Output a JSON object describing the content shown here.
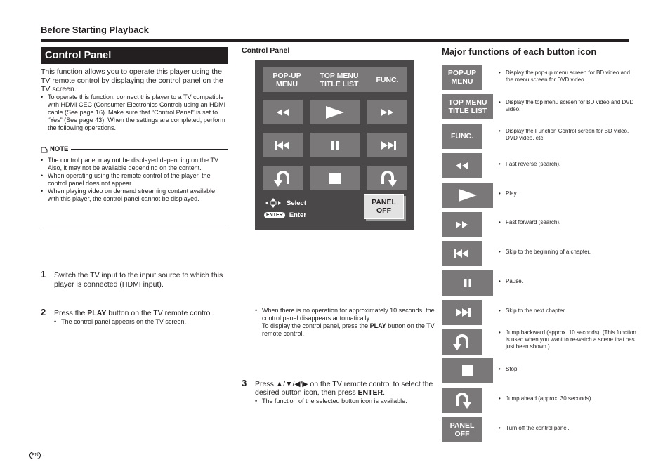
{
  "header": {
    "section": "Before Starting Playback"
  },
  "left": {
    "title": "Control Panel",
    "intro": "This function allows you to operate this player using the TV remote control by displaying the control panel on the TV screen.",
    "intro_bullet": "To operate this function, connect this player to a TV compatible with HDMI CEC (Consumer Electronics Control) using an HDMI cable (See page 16). Make sure that “Control Panel” is set to “Yes” (See page 43). When the settings are completed, perform the following operations.",
    "note_label": "NOTE",
    "notes": [
      "The control panel may not be displayed depending on the TV. Also, it may not be available depending on the content.",
      "When operating using the remote control of the player, the control panel does not appear.",
      "When playing video on demand streaming content available with this player, the control panel cannot be displayed."
    ],
    "steps": [
      {
        "num": "1",
        "text": "Switch the TV input to the input source to which this player is connected (HDMI input)."
      },
      {
        "num": "2",
        "pre": "Press the ",
        "bold": "PLAY",
        "post": " button on the TV remote control.",
        "sub": "The control panel appears on the TV screen."
      }
    ]
  },
  "middle": {
    "label": "Control Panel",
    "buttons": {
      "popup_menu": "POP-UP MENU",
      "top_menu": "TOP MENU TITLE LIST",
      "func": "FUNC.",
      "panel_off": "PANEL OFF"
    },
    "legend": {
      "select": "Select",
      "enter_key": "ENTER",
      "enter": "Enter"
    },
    "bullet_pre": "When there is no operation for approximately 10 seconds, the control panel disappears automatically.",
    "bullet_line2_pre": "To display the control panel, press the ",
    "bullet_line2_bold": "PLAY",
    "bullet_line2_post": " button on the TV remote control.",
    "step3": {
      "num": "3",
      "pre": "Press ▲/▼/◀/▶ on the TV remote control to select the desired button icon, then press ",
      "bold": "ENTER",
      "post": ".",
      "sub": "The function of the selected button icon is available."
    }
  },
  "right": {
    "title": "Major functions of each button icon",
    "items": [
      {
        "icon": "popup-menu",
        "label": "POP-UP MENU",
        "desc": "Display the pop-up menu screen for BD video and the menu screen for DVD video."
      },
      {
        "icon": "top-menu",
        "label": "TOP MENU TITLE LIST",
        "desc": "Display the top menu screen for BD video and DVD video."
      },
      {
        "icon": "func",
        "label": "FUNC.",
        "desc": "Display the Function Control screen for BD video, DVD video, etc."
      },
      {
        "icon": "fast-reverse",
        "desc": "Fast reverse (search)."
      },
      {
        "icon": "play",
        "desc": "Play."
      },
      {
        "icon": "fast-forward",
        "desc": "Fast forward (search)."
      },
      {
        "icon": "skip-back",
        "desc": "Skip to the beginning of a chapter."
      },
      {
        "icon": "pause",
        "desc": "Pause."
      },
      {
        "icon": "skip-next",
        "desc": "Skip to the next chapter."
      },
      {
        "icon": "jump-back",
        "desc": "Jump backward (approx. 10 seconds). (This function is used when you want to re-watch a scene that has just been shown.)"
      },
      {
        "icon": "stop",
        "desc": "Stop."
      },
      {
        "icon": "jump-ahead",
        "desc": "Jump ahead (approx. 30 seconds)."
      },
      {
        "icon": "panel-off",
        "label": "PANEL OFF",
        "desc": "Turn off the control panel."
      }
    ]
  },
  "footer": {
    "lang": "EN",
    "sep": "-"
  }
}
